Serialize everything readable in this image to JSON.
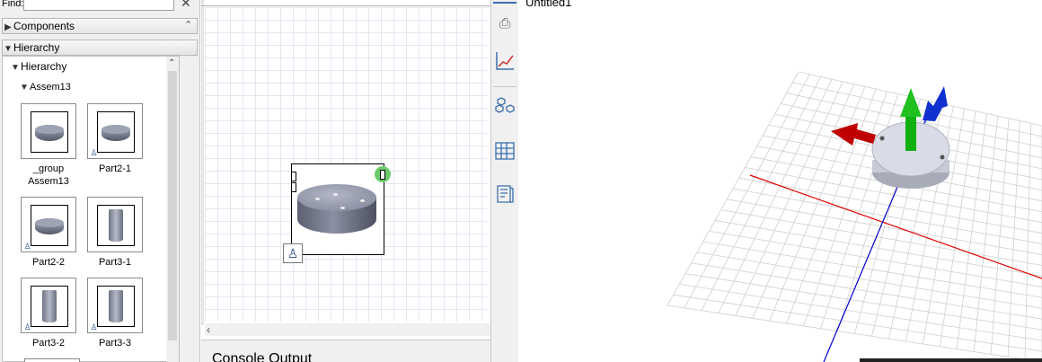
{
  "find": {
    "label": "Find:",
    "value": "",
    "clear_icon": "close-icon"
  },
  "sections": {
    "components": "Components",
    "hierarchy": "Hierarchy"
  },
  "hierarchy_tree": {
    "root": "Hierarchy",
    "assembly": "Assem13",
    "items": [
      {
        "line1": "_group",
        "line2": "Assem13",
        "shape": "disc"
      },
      {
        "line1": "Part2-1",
        "line2": "",
        "shape": "disc"
      },
      {
        "line1": "Part2-2",
        "line2": "",
        "shape": "disc"
      },
      {
        "line1": "Part3-1",
        "line2": "",
        "shape": "tube"
      },
      {
        "line1": "Part3-2",
        "line2": "",
        "shape": "tube"
      },
      {
        "line1": "Part3-3",
        "line2": "",
        "shape": "tube"
      }
    ]
  },
  "canvas": {
    "console_title": "Console Output"
  },
  "toolbar": {
    "tools": [
      "lock-icon",
      "graph-icon",
      "assembly-icon",
      "table-icon",
      "document-icon"
    ]
  },
  "view3d": {
    "title": "Untitled1",
    "colors": {
      "x_axis": "#e00000",
      "y_axis": "#0000cc",
      "arrow_red": "#c00000",
      "arrow_green": "#10b010",
      "arrow_blue": "#1030d0",
      "grid": "#cfcfcf"
    }
  }
}
